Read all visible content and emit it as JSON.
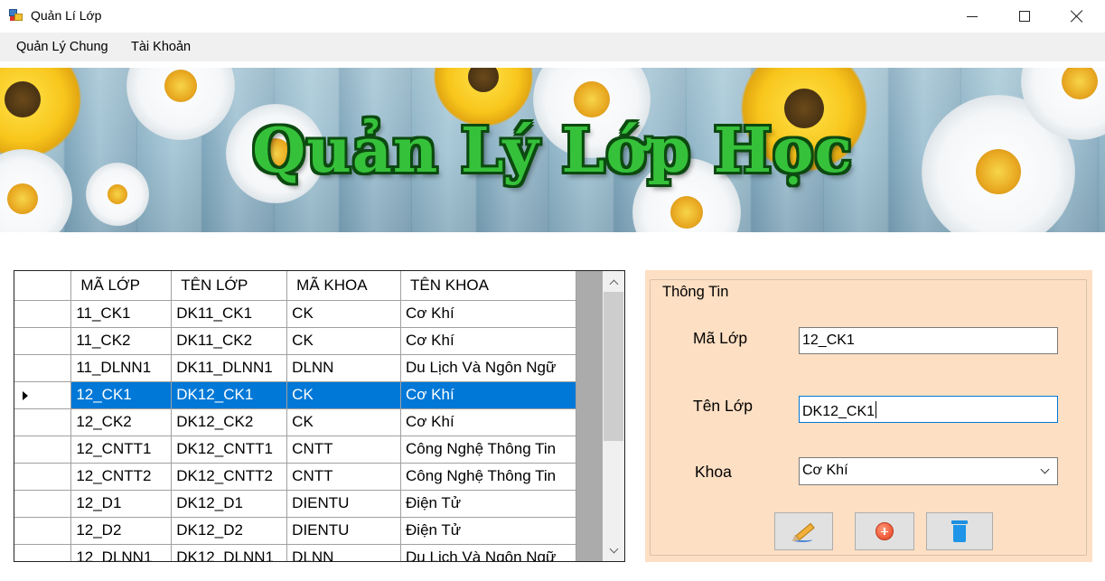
{
  "window": {
    "title": "Quản Lí Lớp"
  },
  "menu": {
    "items": [
      "Quản Lý Chung",
      "Tài Khoản"
    ]
  },
  "banner": {
    "title": "Quản Lý Lớp Học"
  },
  "grid": {
    "columns": [
      "MÃ LỚP",
      "TÊN LỚP",
      "MÃ KHOA",
      "TÊN KHOA"
    ],
    "selected_row_index": 3,
    "rows": [
      [
        "11_CK1",
        "DK11_CK1",
        "CK",
        "Cơ Khí"
      ],
      [
        "11_CK2",
        "DK11_CK2",
        "CK",
        "Cơ Khí"
      ],
      [
        "11_DLNN1",
        "DK11_DLNN1",
        "DLNN",
        "Du Lịch Và Ngôn Ngữ"
      ],
      [
        "12_CK1",
        "DK12_CK1",
        "CK",
        "Cơ Khí"
      ],
      [
        "12_CK2",
        "DK12_CK2",
        "CK",
        "Cơ Khí"
      ],
      [
        "12_CNTT1",
        "DK12_CNTT1",
        "CNTT",
        "Công Nghệ Thông Tin"
      ],
      [
        "12_CNTT2",
        "DK12_CNTT2",
        "CNTT",
        "Công Nghệ Thông Tin"
      ],
      [
        "12_D1",
        "DK12_D1",
        "DIENTU",
        "Điện Tử"
      ],
      [
        "12_D2",
        "DK12_D2",
        "DIENTU",
        "Điện Tử"
      ],
      [
        "12_DLNN1",
        "DK12_DLNN1",
        "DLNN",
        "Du Lịch Và Ngôn Ngữ"
      ]
    ]
  },
  "info": {
    "group_title": "Thông Tin",
    "ma_lop_label": "Mã Lớp",
    "ma_lop_value": "12_CK1",
    "ten_lop_label": "Tên Lớp",
    "ten_lop_value": "DK12_CK1",
    "khoa_label": "Khoa",
    "khoa_value": "Cơ Khí"
  },
  "buttons": {
    "edit_icon": "pencil-icon",
    "add_icon": "plus-circle-icon",
    "delete_icon": "trash-icon"
  },
  "colors": {
    "selection": "#0078d7",
    "panel_background": "#fddfc3",
    "banner_title": "#36c13a"
  }
}
